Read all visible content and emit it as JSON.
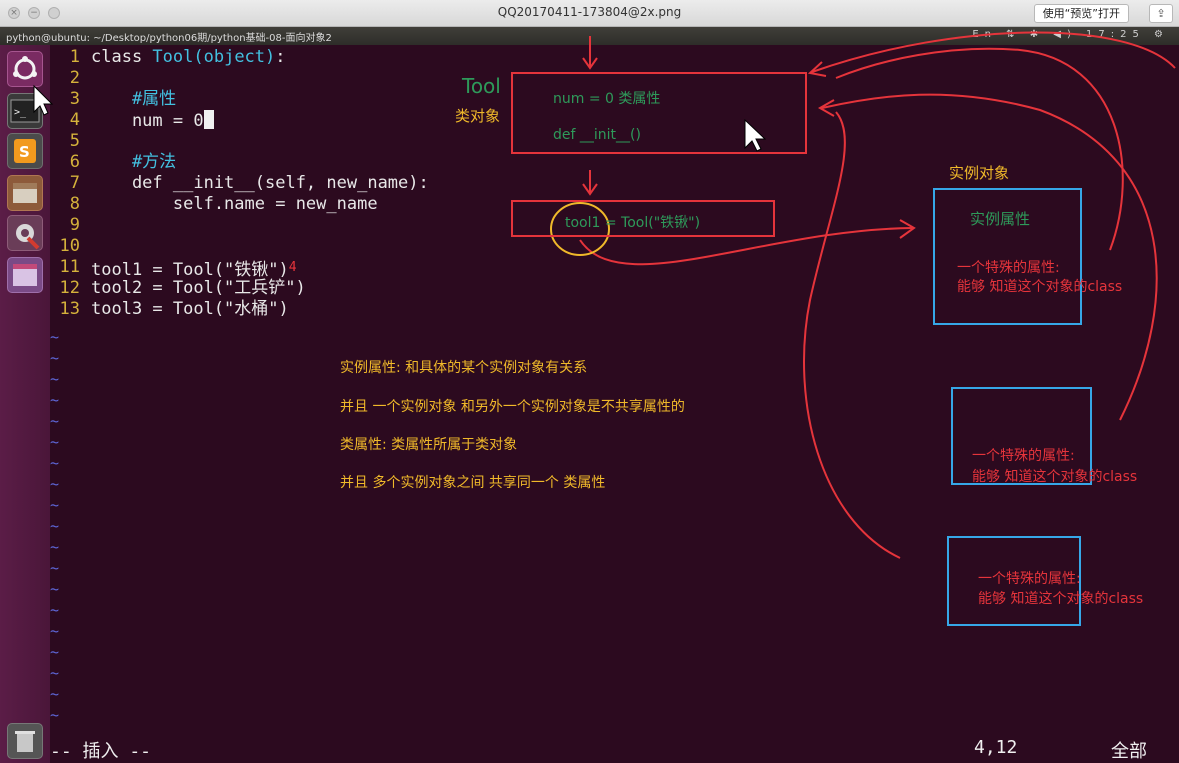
{
  "preview_window": {
    "title": "QQ20170411-173804@2x.png",
    "open_button": "使用“预览”打开",
    "share_icon": "share-icon"
  },
  "ubuntu_panel": {
    "title": "python@ubuntu: ~/Desktop/python06期/python基础-08-面向对象2",
    "tray": "En ⇅ ✱ ◀) 17:25 ⚙"
  },
  "launcher": [
    "ubuntu-dash-icon",
    "terminal-icon",
    "sublime-text-icon",
    "file-manager-icon",
    "system-settings-icon",
    "workspace-switcher-icon",
    "trash-icon"
  ],
  "editor": {
    "lines": [
      {
        "n": "1",
        "text": "class Tool(object):"
      },
      {
        "n": "2",
        "text": ""
      },
      {
        "n": "3",
        "text": "    #属性"
      },
      {
        "n": "4",
        "text": "    num = 0"
      },
      {
        "n": "5",
        "text": ""
      },
      {
        "n": "6",
        "text": "    #方法"
      },
      {
        "n": "7",
        "text": "    def __init__(self, new_name):"
      },
      {
        "n": "8",
        "text": "        self.name = new_name"
      },
      {
        "n": "9",
        "text": ""
      },
      {
        "n": "10",
        "text": ""
      },
      {
        "n": "11",
        "text": "tool1 = Tool(\"铁锹\")"
      },
      {
        "n": "12",
        "text": "tool2 = Tool(\"工兵铲\")"
      },
      {
        "n": "13",
        "text": "tool3 = Tool(\"水桶\")"
      }
    ],
    "tilde": "~",
    "mode": "-- 插入 --",
    "position": "4,12",
    "scroll": "全部"
  },
  "annotations": {
    "class_label": "Tool",
    "class_object_label": "类对象",
    "class_box_line1": "num = 0 类属性",
    "class_box_line2": "def __init__()",
    "instance_box": "tool1 = Tool(\"铁锹\")",
    "instance_object_label": "实例对象",
    "instance_attr_label": "实例属性",
    "special_attr": "一个特殊的属性:",
    "special_attr_desc": "能够 知道这个对象的class",
    "notes": [
      "实例属性:  和具体的某个实例对象有关系",
      "并且 一个实例对象 和另外一个实例对象是不共享属性的",
      "类属性:  类属性所属于类对象",
      "并且 多个实例对象之间 共享同一个 类属性"
    ],
    "mark_after_line11": "4"
  },
  "colors": {
    "background": "#2c0a1f",
    "line_number": "#d5b23b",
    "annotation_red": "#e5343b",
    "annotation_green": "#2e9a5a",
    "annotation_blue": "#36a7e8",
    "annotation_yellow": "#f0b92a"
  }
}
